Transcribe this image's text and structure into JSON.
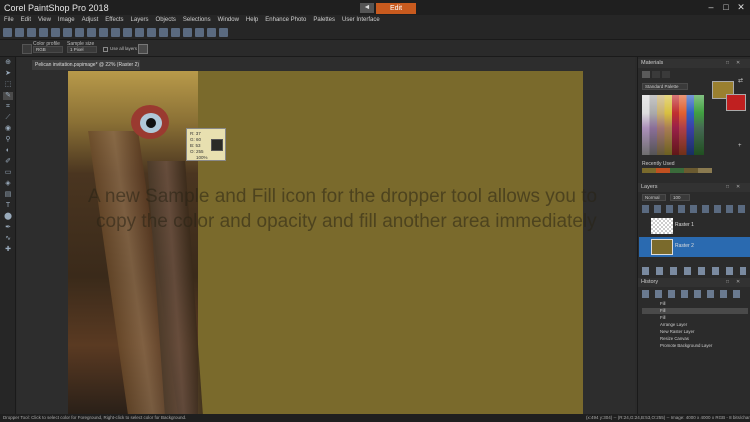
{
  "app": {
    "title": "Corel PaintShop Pro 2018",
    "workspace_tab": "Edit",
    "back_glyph": "◄"
  },
  "window_controls": {
    "minimize": "–",
    "maximize": "□",
    "close": "✕"
  },
  "menu": [
    "File",
    "Edit",
    "View",
    "Image",
    "Adjust",
    "Effects",
    "Layers",
    "Objects",
    "Selections",
    "Window",
    "Help",
    "Enhance Photo",
    "Palettes",
    "User Interface"
  ],
  "tool_options": {
    "color_profile_label": "Color profile",
    "color_profile_value": "RGB",
    "sample_size_label": "Sample size",
    "sample_size_value": "1 Pixel",
    "use_all_layers_label": "Use all layers"
  },
  "document": {
    "tab_title": "Pelican invitation.pspimage* @ 22% (Raster 2)"
  },
  "sample_popup": {
    "r": "R: 37",
    "g": "G: 60",
    "b": "B: 53",
    "o": "O: 255",
    "pct": "100%"
  },
  "caption": {
    "line1": "A new Sample and Fill icon for the dropper tool allows you to",
    "line2": "copy the color and opacity and fill another area immediately"
  },
  "materials": {
    "title": "Materials",
    "palette_select": "Standard Palette",
    "recently_used": "Recently Used"
  },
  "layers": {
    "title": "Layers",
    "blend_mode": "Normal",
    "opacity": "100",
    "items": [
      {
        "name": "Raster 1"
      },
      {
        "name": "Raster 2"
      }
    ]
  },
  "history": {
    "title": "History",
    "items": [
      "Fill",
      "Fill",
      "Fill",
      "Arrange Layer",
      "New Raster Layer",
      "Resize Canvas",
      "Promote Background Layer"
    ]
  },
  "status": {
    "left": "Dropper Tool: Click to select color for Foreground, Right-click to select color for Background.",
    "right": "(x:494 y:304) -- (R:24,G:24,B:53,O:255) -- Image: 4000 x 4000 x RGB - 8 bits/channel"
  },
  "colors": {
    "canvas_fill": "#7a6a2c",
    "foreground": "#9a8030",
    "background": "#c02020",
    "workspace_accent": "#c85a1e",
    "selection": "#2a6ab0"
  }
}
